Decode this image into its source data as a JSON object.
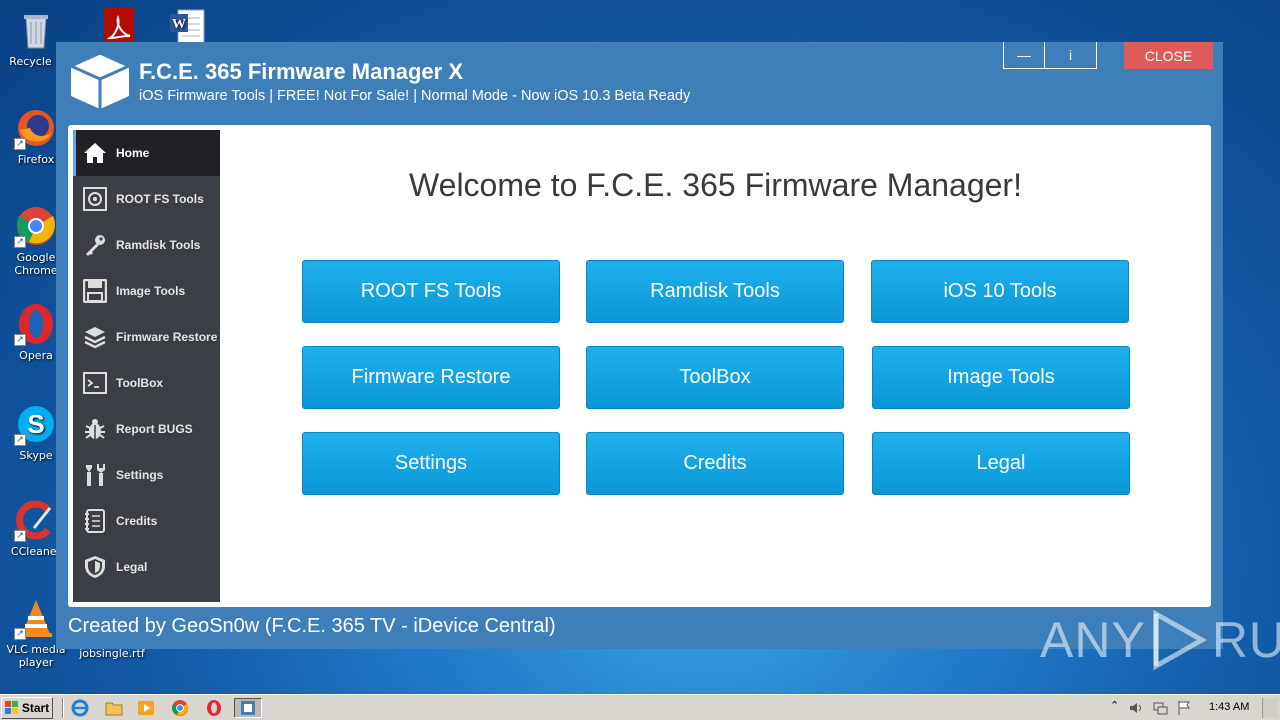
{
  "desktop": {
    "icons": [
      {
        "label": "Recycle B"
      },
      {
        "label": "Firefox"
      },
      {
        "label": "Google Chrome"
      },
      {
        "label": "Opera"
      },
      {
        "label": "Skype"
      },
      {
        "label": "CCleaner"
      },
      {
        "label": "VLC media player"
      },
      {
        "label": "jobsingle.rtf"
      }
    ]
  },
  "app": {
    "title": "F.C.E. 365 Firmware Manager X",
    "subtitle": "iOS Firmware Tools | FREE! Not For Sale! | Normal Mode - Now iOS 10.3 Beta Ready",
    "window_buttons": {
      "minimize": "—",
      "info": "i",
      "close": "CLOSE"
    },
    "colors": {
      "window_bg": "#3f7fb9",
      "tile": "#12a4e2",
      "close": "#e05a5a",
      "sidebar": "#3b3e45"
    },
    "sidebar": [
      {
        "label": "Home",
        "icon": "home-icon",
        "active": true
      },
      {
        "label": "ROOT FS Tools",
        "icon": "root-fs-icon"
      },
      {
        "label": "Ramdisk Tools",
        "icon": "key-icon"
      },
      {
        "label": "Image Tools",
        "icon": "floppy-icon"
      },
      {
        "label": "Firmware Restore",
        "icon": "layers-icon"
      },
      {
        "label": "ToolBox",
        "icon": "terminal-icon"
      },
      {
        "label": "Report BUGS",
        "icon": "bug-icon"
      },
      {
        "label": "Settings",
        "icon": "tools-icon"
      },
      {
        "label": "Credits",
        "icon": "notebook-icon"
      },
      {
        "label": "Legal",
        "icon": "shield-icon"
      }
    ],
    "welcome": "Welcome to F.C.E. 365 Firmware Manager!",
    "tiles": [
      "ROOT FS Tools",
      "Ramdisk Tools",
      "iOS 10 Tools",
      "Firmware Restore",
      "ToolBox",
      "Image Tools",
      "Settings",
      "Credits",
      "Legal"
    ],
    "footer": "Created by GeoSn0w (F.C.E. 365 TV - iDevice Central)"
  },
  "watermark": {
    "left": "ANY",
    "right": "RUN"
  },
  "taskbar": {
    "start_label": "Start",
    "clock": "1:43 AM"
  }
}
